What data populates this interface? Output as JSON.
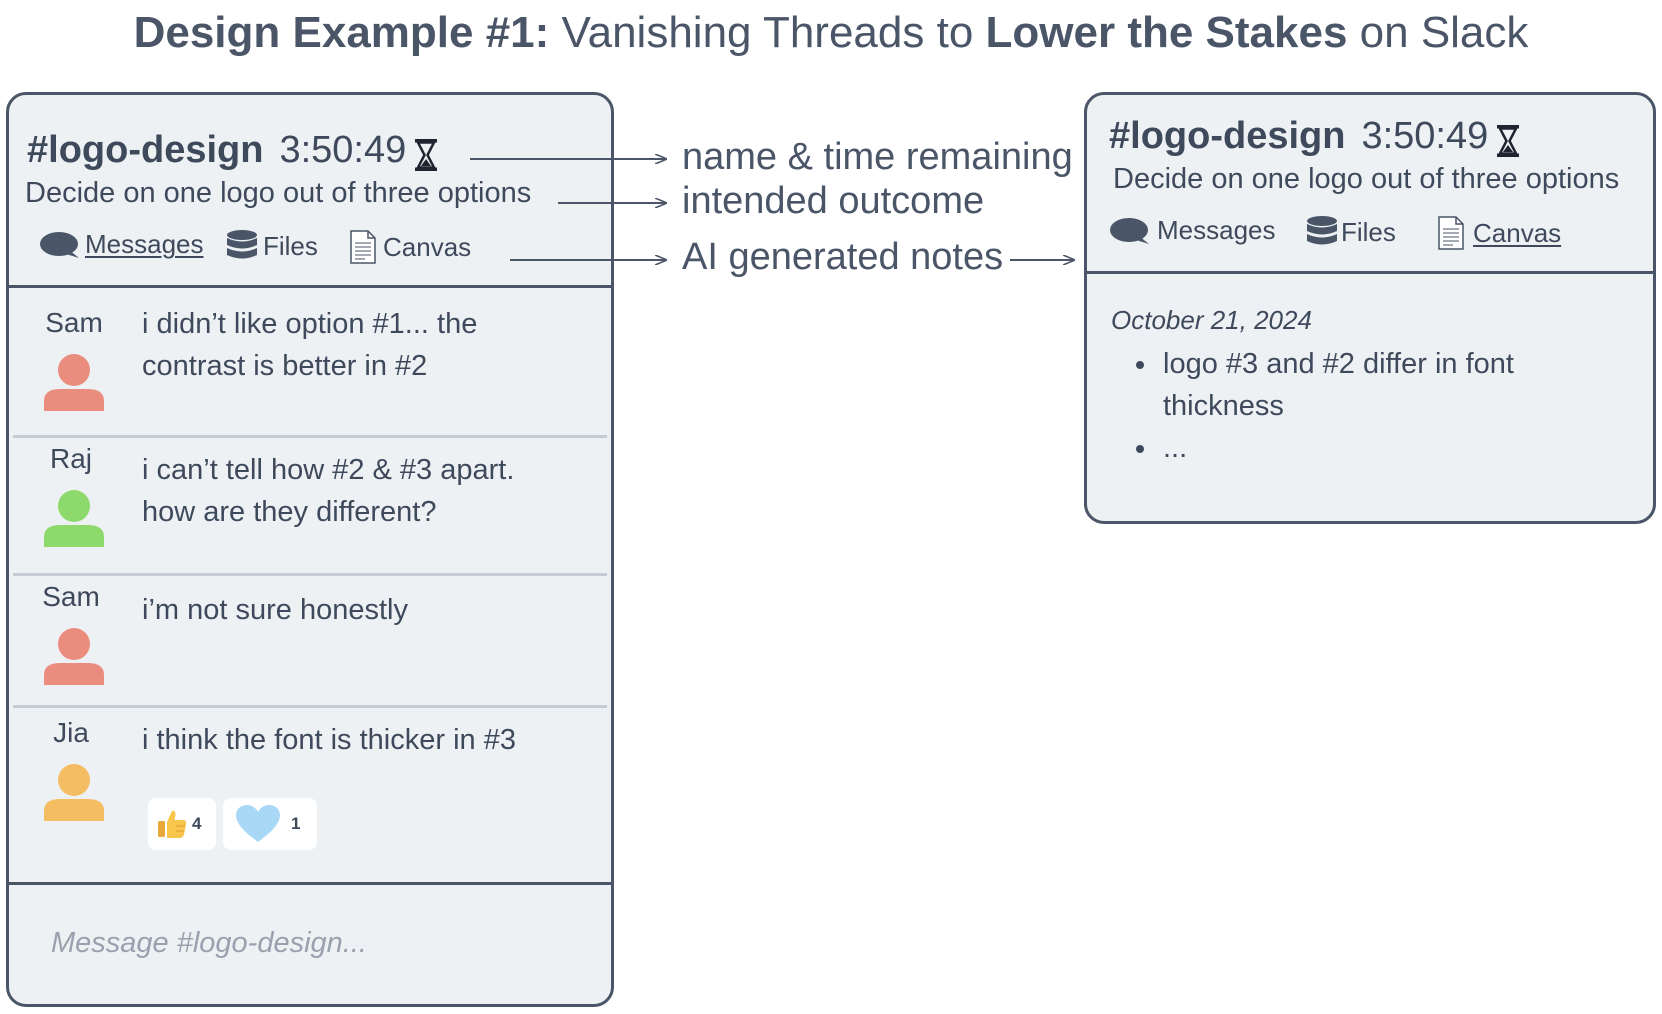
{
  "title": {
    "part1_bold": "Design Example #1:",
    "part2": " Vanishing Threads to ",
    "part3_bold": "Lower the Stakes",
    "part4": " on Slack"
  },
  "channel": {
    "name": "#logo-design",
    "time_remaining": "3:50:49",
    "purpose": "Decide on one logo out of three options"
  },
  "tabs": [
    {
      "label": "Messages",
      "icon": "speech-bubble-icon"
    },
    {
      "label": "Files",
      "icon": "database-icon"
    },
    {
      "label": "Canvas",
      "icon": "document-icon"
    }
  ],
  "messages": [
    {
      "user": "Sam",
      "text": "i didn’t like option #1... the contrast is better in #2",
      "avatar_color": "#ea8c7e"
    },
    {
      "user": "Raj",
      "text": "i can’t tell how #2 & #3 apart. how are they different?",
      "avatar_color": "#8ed96b"
    },
    {
      "user": "Sam",
      "text": "i’m not sure honestly",
      "avatar_color": "#ea8c7e"
    },
    {
      "user": "Jia",
      "text": "i think the font is thicker in #3",
      "avatar_color": "#f4bd62"
    }
  ],
  "reactions": [
    {
      "icon": "thumbs-up-icon",
      "count": "4"
    },
    {
      "icon": "heart-icon",
      "count": "1"
    }
  ],
  "composer": {
    "placeholder": "Message #logo-design..."
  },
  "annotations": {
    "name_time": "name & time remaining",
    "outcome": "intended outcome",
    "notes": "AI generated notes"
  },
  "canvas": {
    "date": "October 21, 2024",
    "notes": [
      "logo #3 and #2 differ in font thickness",
      "..."
    ]
  },
  "colors": {
    "border": "#4a5567",
    "panel_bg": "#eef1f4",
    "heart": "#a9d8f7",
    "thumb": "#f7c64a"
  }
}
